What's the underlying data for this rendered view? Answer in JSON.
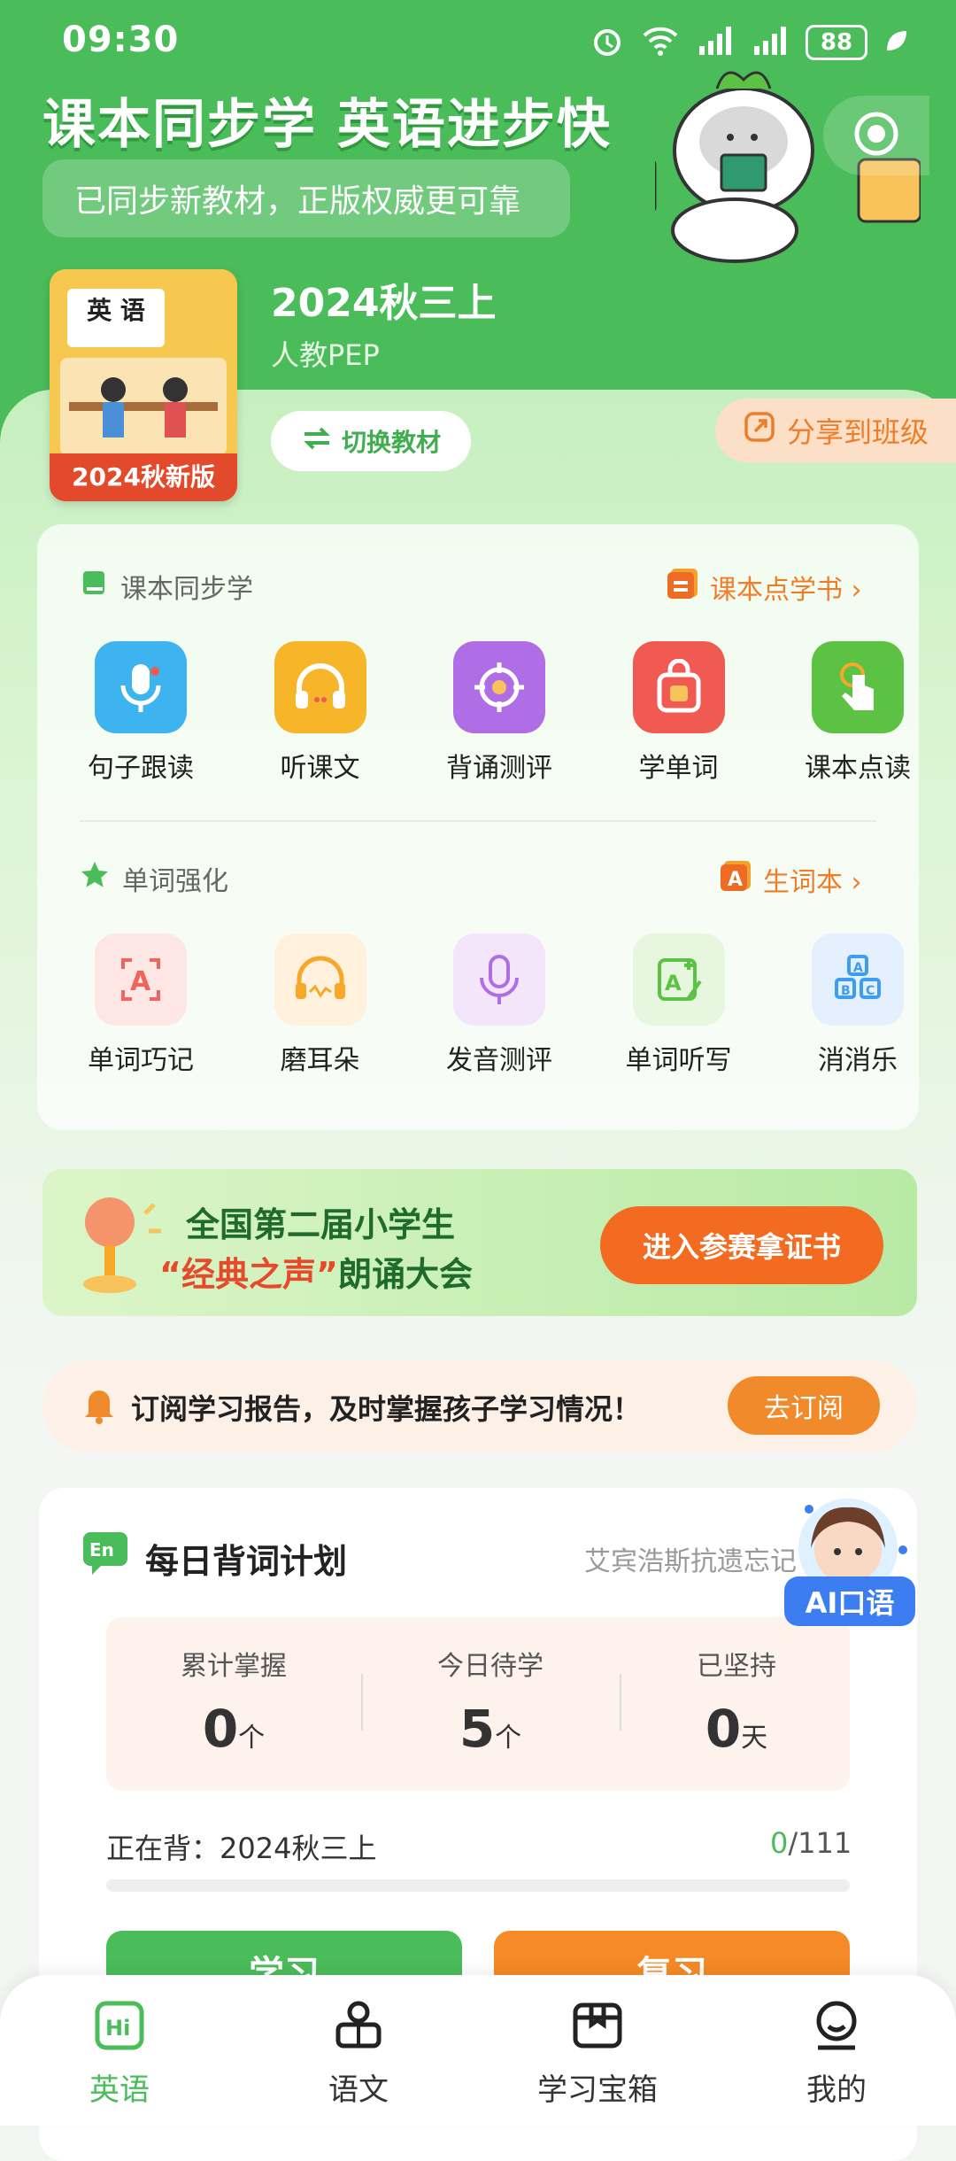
{
  "status_bar": {
    "time": "09:30",
    "battery": "88"
  },
  "header": {
    "headline": "课本同步学 英语进步快",
    "subtitle": "已同步新教材，正版权威更可靠"
  },
  "textbook": {
    "cover_title": "英 语",
    "cover_edition": "2024秋新版",
    "title": "2024秋三上",
    "publisher": "人教PEP",
    "switch_label": "切换教材",
    "share_label": "分享到班级"
  },
  "sync_section": {
    "title": "课本同步学",
    "link": "课本点学书 ›",
    "items": [
      {
        "label": "句子跟读",
        "icon": "microphone-icon",
        "color": "#3db3ef"
      },
      {
        "label": "听课文",
        "icon": "headphones-icon",
        "color": "#f7b52a"
      },
      {
        "label": "背诵测评",
        "icon": "target-icon",
        "color": "#b06ee6"
      },
      {
        "label": "学单词",
        "icon": "word-bag-icon",
        "color": "#f05a52"
      },
      {
        "label": "课本点读",
        "icon": "tap-finger-icon",
        "color": "#5cc244"
      }
    ]
  },
  "word_section": {
    "title": "单词强化",
    "link": "生词本 ›",
    "items": [
      {
        "label": "单词巧记",
        "icon": "letter-a-icon",
        "color": "#f0645e"
      },
      {
        "label": "磨耳朵",
        "icon": "earphone-icon",
        "color": "#f7a72a"
      },
      {
        "label": "发音测评",
        "icon": "microphone-icon",
        "color": "#b06ee6"
      },
      {
        "label": "单词听写",
        "icon": "write-icon",
        "color": "#5cc244"
      },
      {
        "label": "消消乐",
        "icon": "blocks-icon",
        "color": "#3d9df2"
      }
    ]
  },
  "banner": {
    "line1": "全国第二届小学生",
    "line2_highlight": "“经典之声”",
    "line2_rest": "朗诵大会",
    "button": "进入参赛拿证书"
  },
  "subscribe": {
    "text": "订阅学习报告，及时掌握孩子学习情况！",
    "button": "去订阅"
  },
  "plan": {
    "title": "每日背词计划",
    "book_name": "艾宾浩斯抗遗忘记",
    "stats": [
      {
        "label": "累计掌握",
        "value": "0",
        "unit": "个"
      },
      {
        "label": "今日待学",
        "value": "5",
        "unit": "个"
      },
      {
        "label": "已坚持",
        "value": "0",
        "unit": "天"
      }
    ],
    "progress_label": "正在背：2024秋三上",
    "progress_done": "0",
    "progress_total": "/111",
    "progress_fraction": 0,
    "learn_button": "学习",
    "review_button": "复习"
  },
  "ai_badge": "AI口语",
  "nav": [
    {
      "label": "英语",
      "icon": "hi-book-icon",
      "active": true
    },
    {
      "label": "语文",
      "icon": "reader-icon",
      "active": false
    },
    {
      "label": "学习宝箱",
      "icon": "treasure-box-icon",
      "active": false
    },
    {
      "label": "我的",
      "icon": "profile-icon",
      "active": false
    }
  ],
  "colors": {
    "primary": "#4bbc5a",
    "accent": "#f26b21"
  }
}
